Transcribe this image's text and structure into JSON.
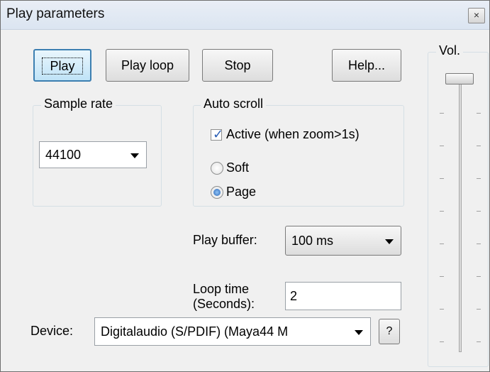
{
  "window": {
    "title": "Play parameters",
    "close_glyph": "×"
  },
  "buttons": {
    "play": "Play",
    "play_loop": "Play loop",
    "stop": "Stop",
    "help": "Help..."
  },
  "sample_rate": {
    "label": "Sample rate",
    "value": "44100"
  },
  "auto_scroll": {
    "label": "Auto scroll",
    "active_label": "Active (when zoom>1s)",
    "active_checked": true,
    "soft_label": "Soft",
    "page_label": "Page",
    "selected": "Page"
  },
  "play_buffer": {
    "label": "Play buffer:",
    "value": "100 ms"
  },
  "loop_time": {
    "label_line1": "Loop time",
    "label_line2": "(Seconds):",
    "value": "2"
  },
  "device": {
    "label": "Device:",
    "value": "Digitalaudio (S/PDIF) (Maya44 M",
    "help_button": "?"
  },
  "volume": {
    "label": "Vol.",
    "level": 1.0
  },
  "colors": {
    "default_button_border": "#3c7fb1",
    "checkbox_mark": "#2b5fb5"
  }
}
